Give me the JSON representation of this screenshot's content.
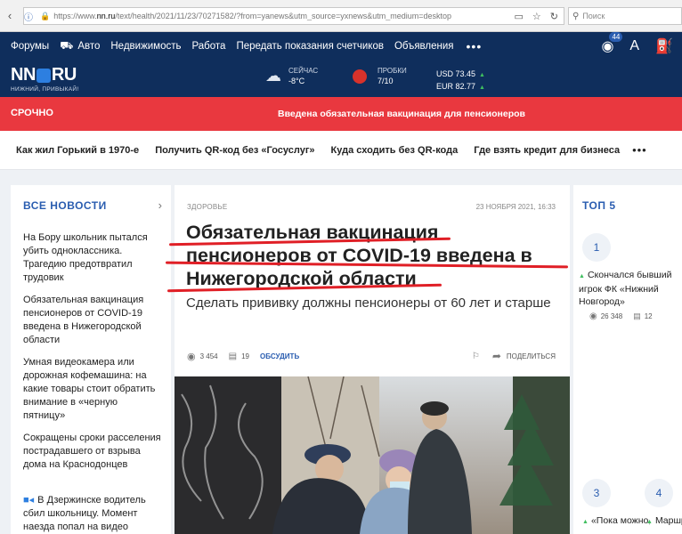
{
  "browser": {
    "url_prefix": "https://www.",
    "url_domain": "nn.ru",
    "url_rest": "/text/health/2021/11/23/70271582/?from=yanews&utm_source=yxnews&utm_medium=desktop",
    "search_placeholder": "Поиск"
  },
  "topnav": {
    "items": [
      "Форумы",
      "Авто",
      "Недвижимость",
      "Работа",
      "Передать показания счетчиков",
      "Объявления"
    ],
    "more": "•••",
    "badge": "44"
  },
  "logo": {
    "left": "NN",
    "right": "RU",
    "slogan": "НИЖНИЙ, ПРИВЫКАЙ!"
  },
  "weather": {
    "label": "СЕЙЧАС",
    "value": "-8°C"
  },
  "traffic": {
    "label": "ПРОБКИ",
    "value": "7/10"
  },
  "rates": {
    "usd": "USD 73.45",
    "eur": "EUR 82.77"
  },
  "urgent": {
    "tag": "СРОЧНО",
    "headline": "Введена обязательная вакцинация для пенсионеров"
  },
  "trending": {
    "items": [
      "Как жил Горький в 1970-е",
      "Получить QR-код без «Госуслуг»",
      "Куда сходить без QR-кода",
      "Где взять кредит для бизнеса"
    ],
    "more": "•••"
  },
  "left": {
    "title": "ВСЕ НОВОСТИ",
    "news": [
      "На Бору школьник пытался убить одноклассника. Трагедию предотвратил трудовик",
      "Обязательная вакцинация пенсионеров от COVID-19 введена в Нижегородской области",
      "Умная видеокамера или дорожная кофемашина: на какие товары стоит обратить внимание в «черную пятницу»",
      "Сокращены сроки расселения пострадавшего от взрыва дома на Краснодонцев",
      "В Дзержинске водитель сбил школьницу. Момент наезда попал на видео"
    ]
  },
  "article": {
    "rubric": "ЗДОРОВЬЕ",
    "date": "23 НОЯБРЯ 2021, 16:33",
    "title": "Обязательная вакцинация пенсионеров от COVID-19 введена в Нижегородской области",
    "subtitle": "Сделать прививку должны пенсионеры от 60 лет и старше",
    "views": "3 454",
    "comments": "19",
    "discuss": "ОБСУДИТЬ",
    "share": "ПОДЕЛИТЬСЯ"
  },
  "right": {
    "title": "ТОП 5",
    "items": [
      {
        "num": "1",
        "title": "Скончался бывший игрок ФК «Нижний Новгород»",
        "views": "26 348",
        "comments": "12"
      },
      {
        "num": "3",
        "title": "«Пока можно, надо в"
      },
      {
        "num": "4",
        "title": "Маршрут говорит"
      }
    ]
  },
  "colors": {
    "navy": "#0f2e5c",
    "accent_red": "#e9383f",
    "link_blue": "#2a5db0"
  }
}
